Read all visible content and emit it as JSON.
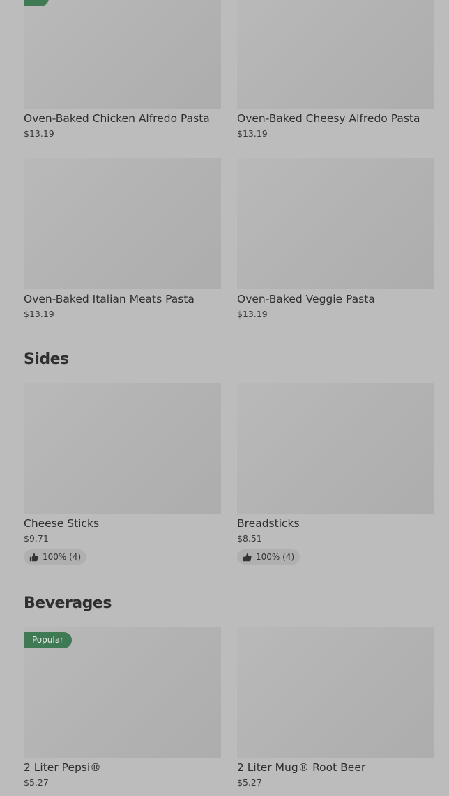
{
  "pasta": {
    "items": [
      {
        "name": "Oven-Baked Chicken Alfredo Pasta",
        "price": "$13.19"
      },
      {
        "name": "Oven-Baked Cheesy Alfredo Pasta",
        "price": "$13.19"
      },
      {
        "name": "Oven-Baked Italian Meats Pasta",
        "price": "$13.19"
      },
      {
        "name": "Oven-Baked Veggie Pasta",
        "price": "$13.19"
      }
    ]
  },
  "sides": {
    "title": "Sides",
    "items": [
      {
        "name": "Cheese Sticks",
        "price": "$9.71",
        "rating": "100% (4)"
      },
      {
        "name": "Breadsticks",
        "price": "$8.51",
        "rating": "100% (4)"
      }
    ]
  },
  "beverages": {
    "title": "Beverages",
    "items": [
      {
        "name": "2 Liter Pepsi®",
        "price": "$5.27",
        "badge": "Popular"
      },
      {
        "name": "2 Liter Mug® Root Beer",
        "price": "$5.27"
      }
    ]
  },
  "colors": {
    "background": "#bcbcbc",
    "badge": "#3f7a55",
    "image_placeholder": "#b3b3b3"
  }
}
